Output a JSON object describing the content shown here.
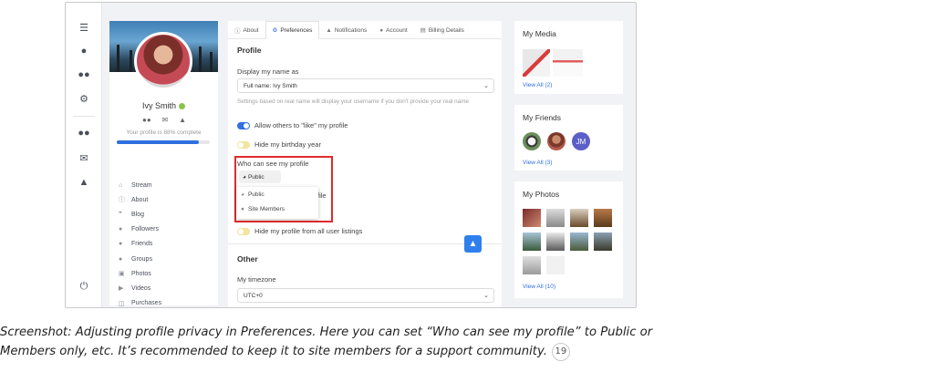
{
  "profile": {
    "name": "Ivy Smith",
    "completion_text": "Your profile is 88% complete",
    "completion": 0.88,
    "nav": [
      "Stream",
      "About",
      "Blog",
      "Followers",
      "Friends",
      "Groups",
      "Photos",
      "Videos",
      "Purchases"
    ]
  },
  "tabs": [
    "About",
    "Preferences",
    "Notifications",
    "Account",
    "Billing Details"
  ],
  "active_tab": "Preferences",
  "preferences": {
    "section_profile": "Profile",
    "display_name_label": "Display my name as",
    "display_name_value": "Full name: Ivy Smith",
    "display_name_hint": "Settings based on real name will display your username if you don't provide your real name",
    "allow_like_label": "Allow others to \"like\" my profile",
    "hide_birthday_label": "Hide my birthday year",
    "who_can_see_label": "Who can see my profile",
    "who_can_see_value": "Public",
    "visibility_options": [
      "Public",
      "Site Members"
    ],
    "peek_text": "file",
    "hide_listings_label": "Hide my profile from all user listings",
    "section_other": "Other",
    "timezone_label": "My timezone",
    "timezone_value": "UTC+0"
  },
  "sidebar": {
    "media_title": "My Media",
    "media_view_all": "View All (2)",
    "friends_title": "My Friends",
    "friends_view_all": "View All (3)",
    "friend_initials": "JM",
    "photos_title": "My Photos",
    "photos_view_all": "View All (10)"
  },
  "colors": {
    "accent": "#2f6fe0",
    "highlight_box": "#e02b2b",
    "online": "#8bc34a"
  },
  "caption": {
    "line1": "Screenshot: Adjusting profile privacy in Preferences. Here you can set “Who can see my profile” to Public or",
    "line2": "Members only, etc. It’s recommended to keep it to site members for a support community.",
    "footnote": "19"
  }
}
